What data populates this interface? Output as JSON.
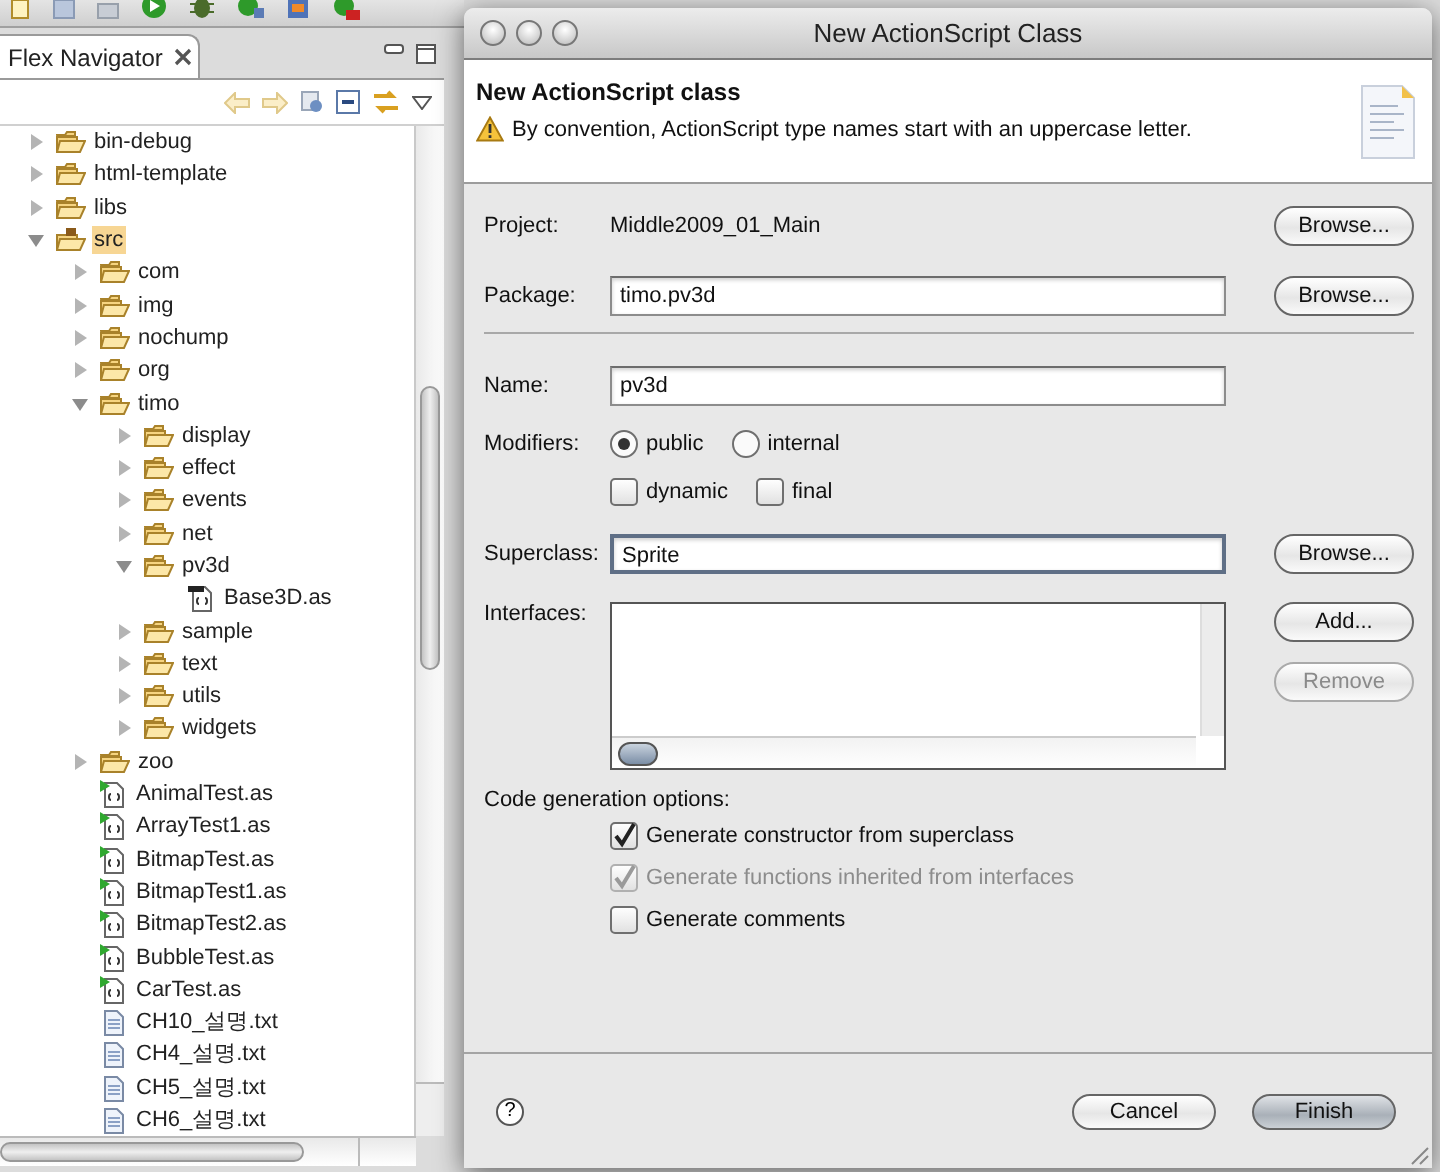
{
  "navigator": {
    "tab": "Flex Navigator"
  },
  "tree": [
    {
      "label": "bin-debug",
      "kind": "folder",
      "expanded": false,
      "selected": false
    },
    {
      "label": "html-template",
      "kind": "folder",
      "expanded": false,
      "selected": false
    },
    {
      "label": "libs",
      "kind": "folder",
      "expanded": false,
      "selected": false
    },
    {
      "label": "src",
      "kind": "source_folder",
      "expanded": true,
      "selected": true,
      "children": [
        {
          "label": "com",
          "kind": "folder",
          "expanded": false,
          "selected": false
        },
        {
          "label": "img",
          "kind": "folder",
          "expanded": false,
          "selected": false
        },
        {
          "label": "nochump",
          "kind": "folder",
          "expanded": false,
          "selected": false
        },
        {
          "label": "org",
          "kind": "folder",
          "expanded": false,
          "selected": false
        },
        {
          "label": "timo",
          "kind": "folder",
          "expanded": true,
          "selected": false,
          "children": [
            {
              "label": "display",
              "kind": "folder",
              "expanded": false,
              "selected": false
            },
            {
              "label": "effect",
              "kind": "folder",
              "expanded": false,
              "selected": false
            },
            {
              "label": "events",
              "kind": "folder",
              "expanded": false,
              "selected": false
            },
            {
              "label": "net",
              "kind": "folder",
              "expanded": false,
              "selected": false
            },
            {
              "label": "pv3d",
              "kind": "folder",
              "expanded": true,
              "selected": false,
              "children": [
                {
                  "label": "Base3D.as",
                  "kind": "class",
                  "selected": false
                }
              ]
            },
            {
              "label": "sample",
              "kind": "folder",
              "expanded": false,
              "selected": false
            },
            {
              "label": "text",
              "kind": "folder",
              "expanded": false,
              "selected": false
            },
            {
              "label": "utils",
              "kind": "folder",
              "expanded": false,
              "selected": false
            },
            {
              "label": "widgets",
              "kind": "folder",
              "expanded": false,
              "selected": false
            }
          ]
        },
        {
          "label": "zoo",
          "kind": "folder",
          "expanded": false,
          "selected": false
        },
        {
          "label": "AnimalTest.as",
          "kind": "app",
          "selected": false
        },
        {
          "label": "ArrayTest1.as",
          "kind": "app",
          "selected": false
        },
        {
          "label": "BitmapTest.as",
          "kind": "app",
          "selected": false
        },
        {
          "label": "BitmapTest1.as",
          "kind": "app",
          "selected": false
        },
        {
          "label": "BitmapTest2.as",
          "kind": "app",
          "selected": false
        },
        {
          "label": "BubbleTest.as",
          "kind": "app",
          "selected": false
        },
        {
          "label": "CarTest.as",
          "kind": "app",
          "selected": false
        },
        {
          "label": "CH10_설명.txt",
          "kind": "text",
          "selected": false
        },
        {
          "label": "CH4_설명.txt",
          "kind": "text",
          "selected": false
        },
        {
          "label": "CH5_설명.txt",
          "kind": "text",
          "selected": false
        },
        {
          "label": "CH6_설명.txt",
          "kind": "text",
          "selected": false
        }
      ]
    }
  ],
  "dialog": {
    "title": "New ActionScript Class",
    "heading": "New ActionScript class",
    "message": "By convention, ActionScript type names start with an uppercase letter.",
    "project": {
      "label": "Project:",
      "value": "Middle2009_01_Main",
      "button": "Browse..."
    },
    "package": {
      "label": "Package:",
      "value": "timo.pv3d",
      "button": "Browse..."
    },
    "name": {
      "label": "Name:",
      "value": "pv3d"
    },
    "modifiers": {
      "label": "Modifiers:",
      "radios": [
        {
          "label": "public",
          "selected": true
        },
        {
          "label": "internal",
          "selected": false
        }
      ],
      "checkboxes": [
        {
          "label": "dynamic",
          "checked": false
        },
        {
          "label": "final",
          "checked": false
        }
      ]
    },
    "superclass": {
      "label": "Superclass:",
      "value": "Sprite",
      "focused": true,
      "button": "Browse..."
    },
    "interfaces": {
      "label": "Interfaces:",
      "buttons": [
        {
          "label": "Add...",
          "disabled": false
        },
        {
          "label": "Remove",
          "disabled": true
        }
      ]
    },
    "code_generation": {
      "label": "Code generation options:",
      "options": [
        {
          "label": "Generate constructor from superclass",
          "checked": true,
          "disabled": false
        },
        {
          "label": "Generate functions inherited from interfaces",
          "checked": true,
          "disabled": true
        },
        {
          "label": "Generate comments",
          "checked": false,
          "disabled": false
        }
      ]
    },
    "help": "?",
    "buttons": [
      {
        "label": "Cancel",
        "default": false
      },
      {
        "label": "Finish",
        "default": true
      }
    ]
  }
}
